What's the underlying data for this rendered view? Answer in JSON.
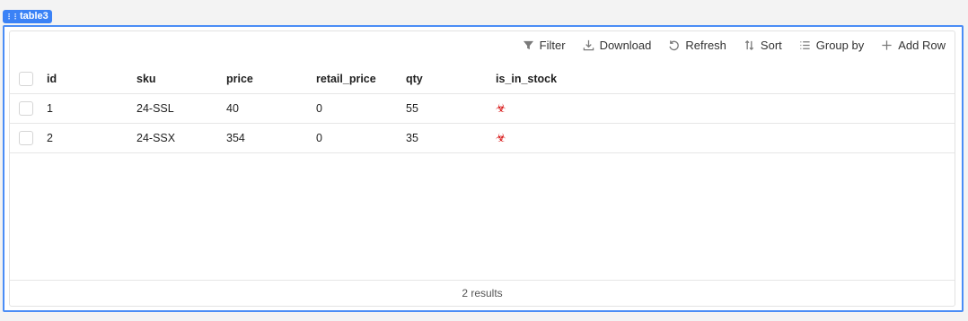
{
  "widget": {
    "name": "table3"
  },
  "toolbar": {
    "filter": "Filter",
    "download": "Download",
    "refresh": "Refresh",
    "sort": "Sort",
    "group_by": "Group by",
    "add_row": "Add Row"
  },
  "table": {
    "columns": [
      "id",
      "sku",
      "price",
      "retail_price",
      "qty",
      "is_in_stock"
    ],
    "rows": [
      {
        "id": "1",
        "sku": "24-SSL",
        "price": "40",
        "retail_price": "0",
        "qty": "55",
        "is_in_stock": "☣"
      },
      {
        "id": "2",
        "sku": "24-SSX",
        "price": "354",
        "retail_price": "0",
        "qty": "35",
        "is_in_stock": "☣"
      }
    ]
  },
  "footer": {
    "results": "2 results"
  },
  "colors": {
    "accent": "#3b82f6",
    "stock_icon": "#d40000"
  }
}
